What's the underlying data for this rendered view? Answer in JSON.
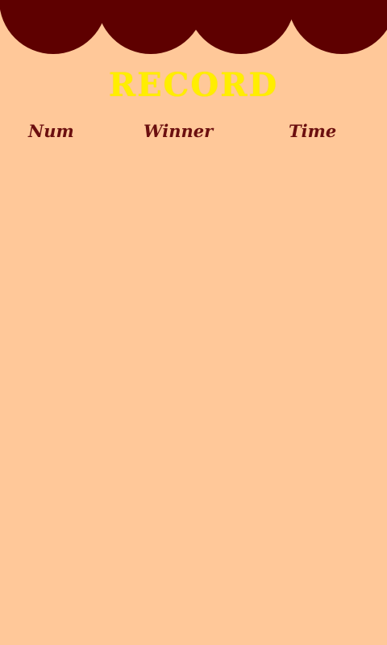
{
  "screen": {
    "title": "RECORD",
    "colors": {
      "background": "#ffc899",
      "scallop": "#5e0000",
      "title": "#ffee00",
      "header_text": "#6b0f0f"
    }
  },
  "table": {
    "headers": {
      "num": "Num",
      "winner": "Winner",
      "time": "Time"
    },
    "rows": []
  }
}
